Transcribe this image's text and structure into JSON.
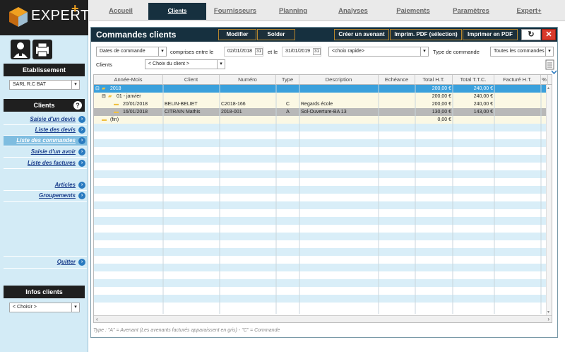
{
  "app": {
    "brand": "EXPERT",
    "brand_plus": "+"
  },
  "sidebar": {
    "etablissement_header": "Etablissement",
    "etablissement_value": "SARL R.C BAT",
    "clients_header": "Clients",
    "links": [
      {
        "label": "Saisie d'un devis"
      },
      {
        "label": "Liste des devis"
      },
      {
        "label": "Liste des commandes"
      },
      {
        "label": "Saisie d'un avoir"
      },
      {
        "label": "Liste des factures"
      },
      {
        "label": "Articles"
      },
      {
        "label": "Groupements"
      },
      {
        "label": "Quitter"
      }
    ],
    "infos_header": "Infos clients",
    "infos_value": "< Choisir >"
  },
  "tabs": [
    "Accueil",
    "Clients",
    "Fournisseurs",
    "Planning",
    "Analyses",
    "Paiements",
    "Paramètres",
    "Expert+"
  ],
  "panel": {
    "title": "Commandes clients",
    "buttons": {
      "modifier": "Modifier",
      "solder": "Solder",
      "avenant": "Créer un avenant",
      "imprim_sel": "Imprim. PDF (sélection)",
      "imprimer": "Imprimer en PDF"
    },
    "filters": {
      "date_type": "Dates de commande",
      "between_label": "comprises entre le",
      "date_from": "02/01/2018",
      "and_label": "et le",
      "date_to": "31/01/2019",
      "quick_choice": "<choix rapide>",
      "type_label": "Type de commande",
      "type_value": "Toutes les commandes",
      "clients_label": "Clients",
      "clients_value": "< Choix du client >"
    }
  },
  "grid": {
    "columns": [
      "Année-Mois",
      "Client",
      "Numéro",
      "Type",
      "Description",
      "Echéance",
      "Total H.T.",
      "Total T.T.C.",
      "Facturé H.T.",
      "%"
    ],
    "rows": [
      {
        "ym": "2018",
        "client": "",
        "num": "",
        "type": "",
        "desc": "",
        "ech": "",
        "ht": "200,00 €",
        "ttc": "240,00 €",
        "fact": ""
      },
      {
        "ym": "01 - janvier",
        "client": "",
        "num": "",
        "type": "",
        "desc": "",
        "ech": "",
        "ht": "200,00 €",
        "ttc": "240,00 €",
        "fact": ""
      },
      {
        "ym": "20/01/2018",
        "client": "BELIN-BELIET",
        "num": "C2018-166",
        "type": "C",
        "desc": "Regards école",
        "ech": "",
        "ht": "200,00 €",
        "ttc": "240,00 €",
        "fact": ""
      },
      {
        "ym": "16/01/2018",
        "client": "CITRAIN Mathis",
        "num": "2018-001",
        "type": "A",
        "desc": "Sol-Ouverture-BA 13",
        "ech": "",
        "ht": "130,00 €",
        "ttc": "143,00 €",
        "fact": ""
      },
      {
        "ym": "(fin)",
        "client": "",
        "num": "",
        "type": "",
        "desc": "",
        "ech": "",
        "ht": "0,00 €",
        "ttc": "",
        "fact": ""
      }
    ]
  },
  "footnote": "Type : \"A\" = Avenant (Les avenants facturés apparaissent en gris)  -  \"C\" = Commande",
  "colors": {
    "dark": "#16303f",
    "accent": "#b7862d",
    "stripe": "#d9eef8",
    "selected": "#3aa0dc",
    "avenant": "#b8b8b8"
  }
}
